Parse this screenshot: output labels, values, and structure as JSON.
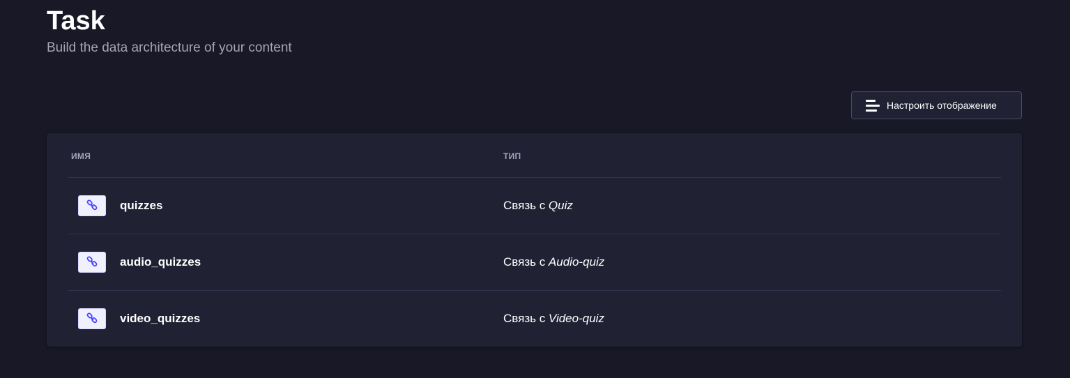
{
  "header": {
    "title": "Task",
    "subtitle": "Build the data architecture of your content"
  },
  "toolbar": {
    "configure_label": "Настроить отображение",
    "configure_icon": "list-settings-icon"
  },
  "table": {
    "columns": {
      "name": "ИМЯ",
      "type": "ТИП"
    },
    "rows": [
      {
        "icon": "relation-link-icon",
        "name": "quizzes",
        "type_prefix": "Связь с ",
        "type_target": "Quiz"
      },
      {
        "icon": "relation-link-icon",
        "name": "audio_quizzes",
        "type_prefix": "Связь с ",
        "type_target": "Audio-quiz"
      },
      {
        "icon": "relation-link-icon",
        "name": "video_quizzes",
        "type_prefix": "Связь с ",
        "type_target": "Video-quiz"
      }
    ]
  },
  "colors": {
    "background": "#181826",
    "card": "#212134",
    "border": "#32324d",
    "muted_text": "#a5a5ba",
    "relation_icon_bg": "#f0f0ff",
    "relation_icon_fg": "#4945ff"
  }
}
